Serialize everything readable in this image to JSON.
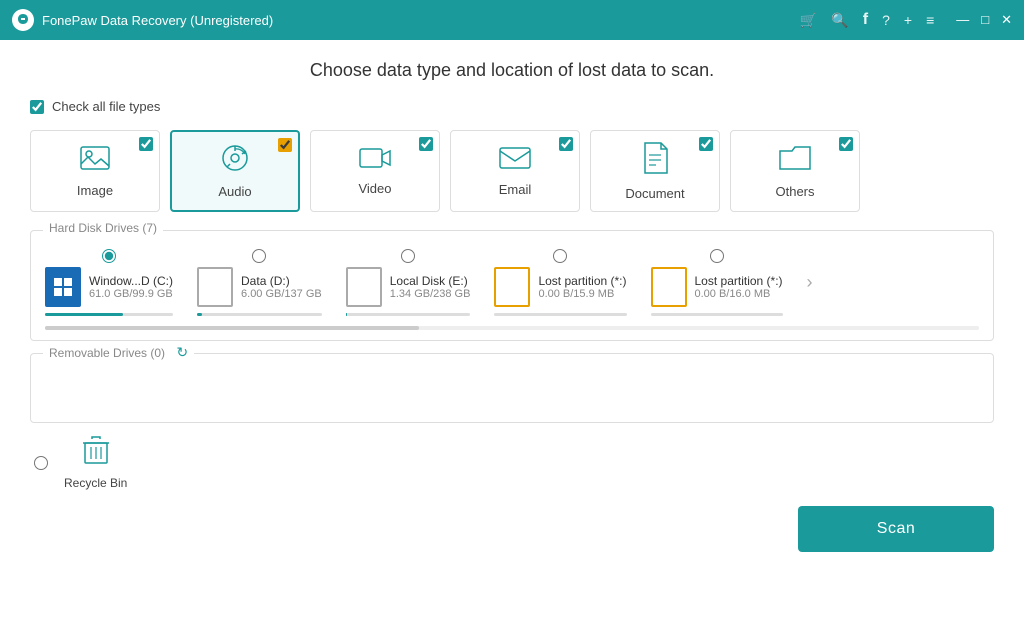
{
  "titleBar": {
    "title": "FonePaw Data Recovery (Unregistered)",
    "icons": [
      "cart-icon",
      "search-icon",
      "facebook-icon",
      "help-icon",
      "plus-icon",
      "menu-icon",
      "minimize-icon",
      "maximize-icon",
      "close-icon"
    ]
  },
  "page": {
    "title": "Choose data type and location of lost data to scan.",
    "checkAll": {
      "label": "Check all file types",
      "checked": true
    }
  },
  "fileTypes": [
    {
      "id": "image",
      "label": "Image",
      "active": false,
      "checked": true
    },
    {
      "id": "audio",
      "label": "Audio",
      "active": true,
      "checked": true
    },
    {
      "id": "video",
      "label": "Video",
      "active": false,
      "checked": true
    },
    {
      "id": "email",
      "label": "Email",
      "active": false,
      "checked": true
    },
    {
      "id": "document",
      "label": "Document",
      "active": false,
      "checked": true
    },
    {
      "id": "others",
      "label": "Others",
      "active": false,
      "checked": true
    }
  ],
  "hardDiskDrives": {
    "sectionLabel": "Hard Disk Drives (7)",
    "drives": [
      {
        "id": "c",
        "name": "Window...D (C:)",
        "size": "61.0 GB/99.9 GB",
        "type": "windows",
        "selected": true,
        "progress": 61
      },
      {
        "id": "d",
        "name": "Data (D:)",
        "size": "6.00 GB/137 GB",
        "type": "normal",
        "selected": false,
        "progress": 4
      },
      {
        "id": "e",
        "name": "Local Disk (E:)",
        "size": "1.34 GB/238 GB",
        "type": "normal",
        "selected": false,
        "progress": 1
      },
      {
        "id": "lp1",
        "name": "Lost partition (*:)",
        "size": "0.00 B/15.9 MB",
        "type": "orange",
        "selected": false,
        "progress": 0
      },
      {
        "id": "lp2",
        "name": "Lost partition (*:)",
        "size": "0.00 B/16.0 MB",
        "type": "orange",
        "selected": false,
        "progress": 0
      }
    ]
  },
  "removableDrives": {
    "sectionLabel": "Removable Drives (0)"
  },
  "recycleBin": {
    "label": "Recycle Bin",
    "selected": false
  },
  "scanButton": {
    "label": "Scan"
  }
}
